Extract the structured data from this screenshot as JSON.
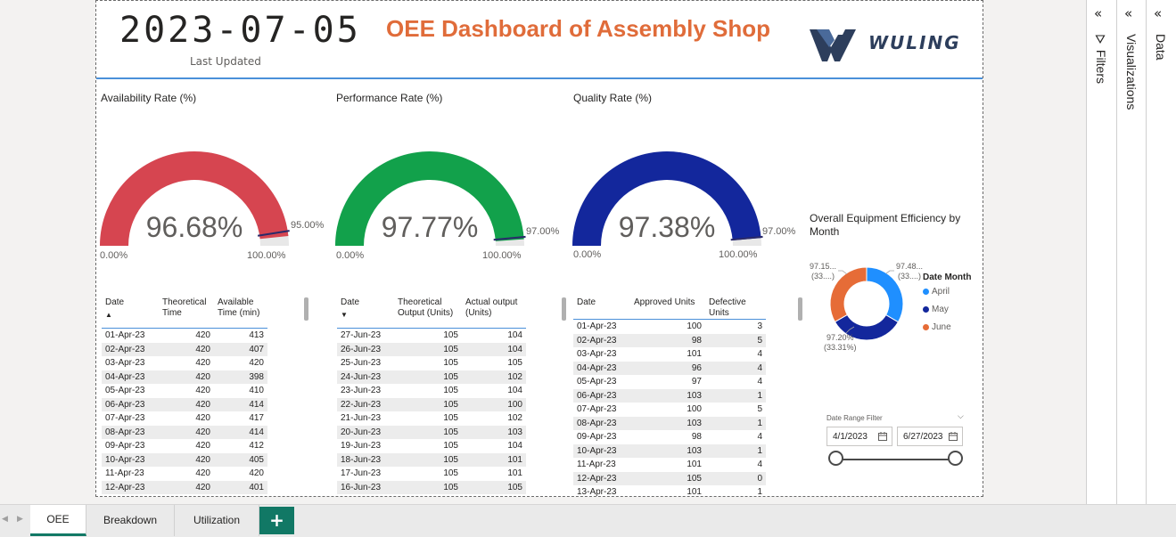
{
  "header": {
    "date": "2023-07-05",
    "last_updated_label": "Last Updated",
    "title": "OEE Dashboard of Assembly Shop",
    "logo_text": "WULING"
  },
  "gauges": [
    {
      "title": "Availability Rate (%)",
      "value": "96.68%",
      "fill_fraction": 0.9668,
      "target": "95.00%",
      "target_fraction": 0.95,
      "min": "0.00%",
      "max": "100.00%",
      "color": "#d64550"
    },
    {
      "title": "Performance Rate (%)",
      "value": "97.77%",
      "fill_fraction": 0.9777,
      "target": "97.00%",
      "target_fraction": 0.97,
      "min": "0.00%",
      "max": "100.00%",
      "color": "#12a14b"
    },
    {
      "title": "Quality Rate (%)",
      "value": "97.38%",
      "fill_fraction": 0.9738,
      "target": "97.00%",
      "target_fraction": 0.97,
      "min": "0.00%",
      "max": "100.00%",
      "color": "#13279c"
    }
  ],
  "table_availability": {
    "headers": [
      "Date",
      "Theoretical Time",
      "Available Time (min)"
    ],
    "sort": "up",
    "rows": [
      [
        "01-Apr-23",
        "420",
        "413"
      ],
      [
        "02-Apr-23",
        "420",
        "407"
      ],
      [
        "03-Apr-23",
        "420",
        "420"
      ],
      [
        "04-Apr-23",
        "420",
        "398"
      ],
      [
        "05-Apr-23",
        "420",
        "410"
      ],
      [
        "06-Apr-23",
        "420",
        "414"
      ],
      [
        "07-Apr-23",
        "420",
        "417"
      ],
      [
        "08-Apr-23",
        "420",
        "414"
      ],
      [
        "09-Apr-23",
        "420",
        "412"
      ],
      [
        "10-Apr-23",
        "420",
        "405"
      ],
      [
        "11-Apr-23",
        "420",
        "420"
      ],
      [
        "12-Apr-23",
        "420",
        "401"
      ]
    ]
  },
  "table_performance": {
    "headers": [
      "Date",
      "Theoretical Output (Units)",
      "Actual output (Units)"
    ],
    "sort": "down",
    "rows": [
      [
        "27-Jun-23",
        "105",
        "104"
      ],
      [
        "26-Jun-23",
        "105",
        "104"
      ],
      [
        "25-Jun-23",
        "105",
        "105"
      ],
      [
        "24-Jun-23",
        "105",
        "102"
      ],
      [
        "23-Jun-23",
        "105",
        "104"
      ],
      [
        "22-Jun-23",
        "105",
        "100"
      ],
      [
        "21-Jun-23",
        "105",
        "102"
      ],
      [
        "20-Jun-23",
        "105",
        "103"
      ],
      [
        "19-Jun-23",
        "105",
        "104"
      ],
      [
        "18-Jun-23",
        "105",
        "101"
      ],
      [
        "17-Jun-23",
        "105",
        "101"
      ],
      [
        "16-Jun-23",
        "105",
        "105"
      ]
    ]
  },
  "table_quality": {
    "headers": [
      "Date",
      "Approved Units",
      "Defective Units"
    ],
    "rows": [
      [
        "01-Apr-23",
        "100",
        "3"
      ],
      [
        "02-Apr-23",
        "98",
        "5"
      ],
      [
        "03-Apr-23",
        "101",
        "4"
      ],
      [
        "04-Apr-23",
        "96",
        "4"
      ],
      [
        "05-Apr-23",
        "97",
        "4"
      ],
      [
        "06-Apr-23",
        "103",
        "1"
      ],
      [
        "07-Apr-23",
        "100",
        "5"
      ],
      [
        "08-Apr-23",
        "103",
        "1"
      ],
      [
        "09-Apr-23",
        "98",
        "4"
      ],
      [
        "10-Apr-23",
        "103",
        "1"
      ],
      [
        "11-Apr-23",
        "101",
        "4"
      ],
      [
        "12-Apr-23",
        "105",
        "0"
      ],
      [
        "13-Apr-23",
        "101",
        "1"
      ]
    ]
  },
  "chart_data": {
    "type": "pie",
    "title": "Overall Equipment Efficiency by Month",
    "legend_title": "Date Month",
    "legend_placement": "right",
    "categories": [
      "April",
      "May",
      "June"
    ],
    "values": [
      97.48,
      97.2,
      97.15
    ],
    "shares": [
      33.35,
      33.31,
      33.34
    ],
    "colors": [
      "#1f8fff",
      "#13279c",
      "#e66c37"
    ],
    "data_labels": [
      {
        "line1": "97.48...",
        "line2": "(33....)"
      },
      {
        "line1": "97.20%",
        "line2": "(33.31%)"
      },
      {
        "line1": "97.15...",
        "line2": "(33....)"
      }
    ]
  },
  "date_filter": {
    "title": "Date Range Filter",
    "start": "4/1/2023",
    "end": "6/27/2023"
  },
  "panes": {
    "filters": "Filters",
    "visualizations": "Visualizations",
    "data": "Data"
  },
  "tabs": [
    "OEE",
    "Breakdown",
    "Utilization"
  ],
  "add_tab_label": "+"
}
